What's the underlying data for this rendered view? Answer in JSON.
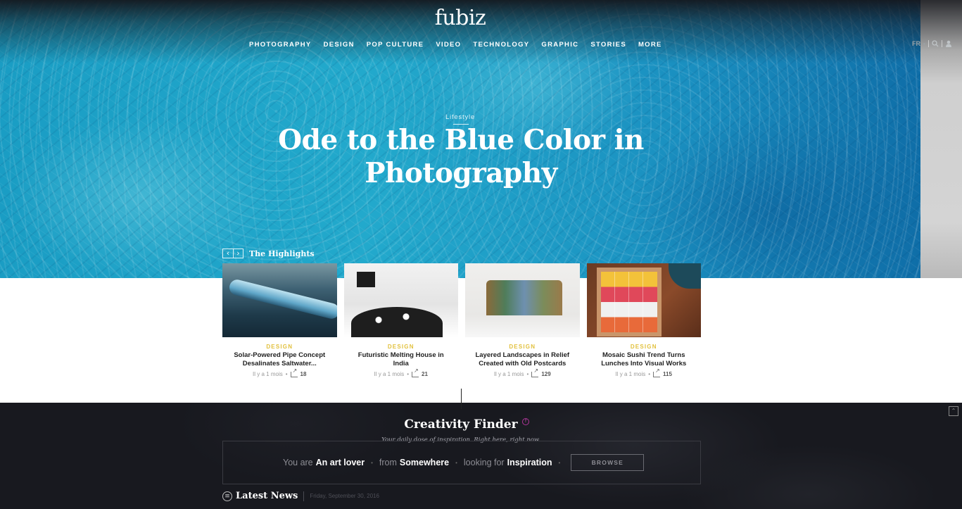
{
  "header": {
    "logo": "fubiz",
    "nav": [
      "PHOTOGRAPHY",
      "DESIGN",
      "POP CULTURE",
      "VIDEO",
      "TECHNOLOGY",
      "GRAPHIC",
      "STORIES",
      "MORE"
    ],
    "language": "FR",
    "icons": [
      "search-icon",
      "user-icon"
    ]
  },
  "hero": {
    "category": "Lifestyle",
    "title": "Ode to the Blue Color in Photography"
  },
  "highlights": {
    "title": "The Highlights",
    "items": [
      {
        "category": "DESIGN",
        "title": "Solar-Powered Pipe Concept Desalinates Saltwater...",
        "time": "Il y a 1 mois",
        "shares": "18"
      },
      {
        "category": "DESIGN",
        "title": "Futuristic Melting House in India",
        "time": "Il y a 1 mois",
        "shares": "21"
      },
      {
        "category": "DESIGN",
        "title": "Layered Landscapes in Relief Created with Old Postcards",
        "time": "Il y a 1 mois",
        "shares": "129"
      },
      {
        "category": "DESIGN",
        "title": "Mosaic Sushi Trend Turns Lunches Into Visual Works",
        "time": "Il y a 1 mois",
        "shares": "115"
      }
    ]
  },
  "creativity_finder": {
    "title": "Creativity Finder",
    "badge": "f",
    "subtitle": "Your daily dose of inspiration. Right here, right now.",
    "you_are_label": "You are",
    "you_are_value": "An art lover",
    "from_label": "from",
    "from_value": "Somewhere",
    "looking_label": "looking for",
    "looking_value": "Inspiration",
    "browse_label": "BROWSE"
  },
  "latest_news": {
    "title": "Latest News",
    "date": "Friday, September 30, 2016"
  },
  "colors": {
    "category_accent": "#e2c13e",
    "dark_bg": "#18191f",
    "badge": "#b0359a"
  }
}
